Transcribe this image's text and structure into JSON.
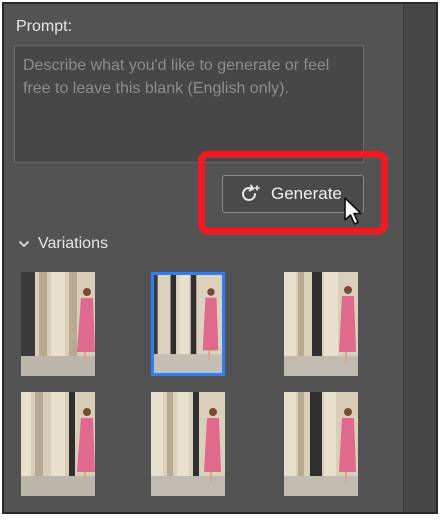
{
  "prompt": {
    "label": "Prompt:",
    "placeholder": "Describe what you'd like to generate or feel free to leave this blank (English only)."
  },
  "generate_button": {
    "label": "Generate",
    "icon": "generate-refresh-icon"
  },
  "variations": {
    "label": "Variations",
    "expanded": true,
    "selected_index": 1,
    "count": 6
  },
  "colors": {
    "panel_bg": "#535353",
    "highlight": "#ee1b22",
    "selection": "#2d7ff9"
  }
}
